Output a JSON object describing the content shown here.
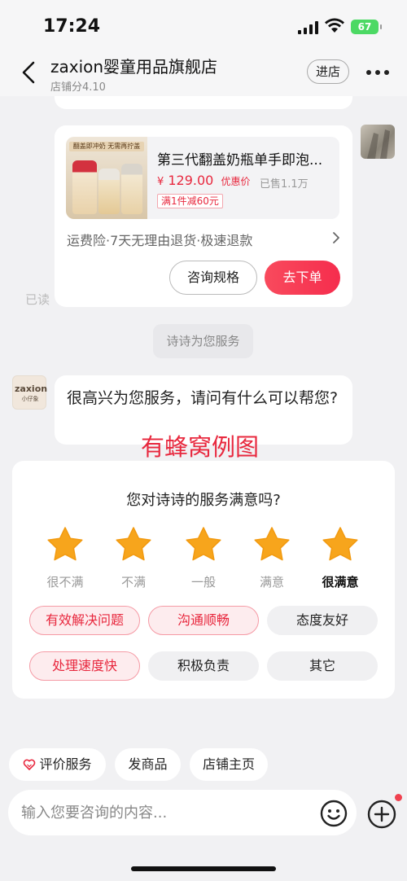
{
  "status_bar": {
    "time": "17:24",
    "battery": "67"
  },
  "header": {
    "shop_name": "zaxion婴童用品旗舰店",
    "shop_score": "店铺分4.10",
    "enter_label": "进店"
  },
  "product_card": {
    "thumb_banner": "翻盖即冲奶 无需再拧盖",
    "title": "第三代翻盖奶瓶单手即泡...",
    "currency": "¥",
    "price": "129.00",
    "price_tag": "优惠价",
    "sold": "已售1.1万",
    "promo": "满1件减60元",
    "service_line": "运费险·7天无理由退货·极速退款",
    "consult_label": "咨询规格",
    "order_label": "去下单"
  },
  "read_status": "已读",
  "system_message": "诗诗为您服务",
  "shop_avatar": {
    "brand": "zaxion",
    "sub": "小仔象"
  },
  "welcome_message": "很高兴为您服务，请问有什么可以帮您?",
  "watermark": "有蜂窝例图",
  "rating": {
    "question": "您对诗诗的服务满意吗?",
    "selected_stars": 5,
    "star_labels": [
      "很不满",
      "不满",
      "一般",
      "满意",
      "很满意"
    ],
    "chips": [
      {
        "label": "有效解决问题",
        "selected": true
      },
      {
        "label": "沟通顺畅",
        "selected": true
      },
      {
        "label": "态度友好",
        "selected": false
      },
      {
        "label": "处理速度快",
        "selected": true
      },
      {
        "label": "积极负责",
        "selected": false
      },
      {
        "label": "其它",
        "selected": false
      }
    ]
  },
  "quick_actions": [
    "评价服务",
    "发商品",
    "店铺主页"
  ],
  "input": {
    "placeholder": "输入您要咨询的内容..."
  },
  "colors": {
    "accent": "#e8283e",
    "star": "#f7a51c",
    "battery": "#4cd964"
  }
}
